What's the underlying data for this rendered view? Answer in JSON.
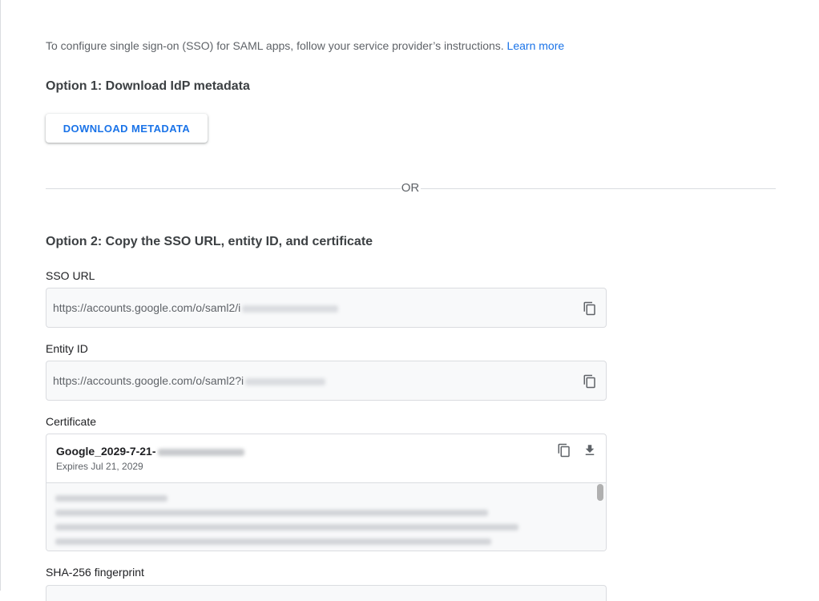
{
  "intro": {
    "text": "To configure single sign-on (SSO) for SAML apps, follow your service provider’s instructions.",
    "link": "Learn more"
  },
  "option1": {
    "heading": "Option 1: Download IdP metadata",
    "button": "DOWNLOAD METADATA"
  },
  "divider": {
    "label": "OR"
  },
  "option2": {
    "heading": "Option 2: Copy the SSO URL, entity ID, and certificate",
    "sso_url": {
      "label": "SSO URL",
      "value": "https://accounts.google.com/o/saml2/i"
    },
    "entity_id": {
      "label": "Entity ID",
      "value": "https://accounts.google.com/o/saml2?i"
    },
    "certificate": {
      "label": "Certificate",
      "name": "Google_2029-7-21-",
      "expires": "Expires Jul 21, 2029"
    },
    "fingerprint": {
      "label": "SHA-256 fingerprint"
    }
  },
  "icons": {
    "copy": "copy-icon",
    "download": "download-icon"
  },
  "colors": {
    "accent": "#1a73e8",
    "text": "#3c4043",
    "muted": "#5f6368",
    "border": "#dadce0",
    "field_bg": "#f8f9fa"
  }
}
